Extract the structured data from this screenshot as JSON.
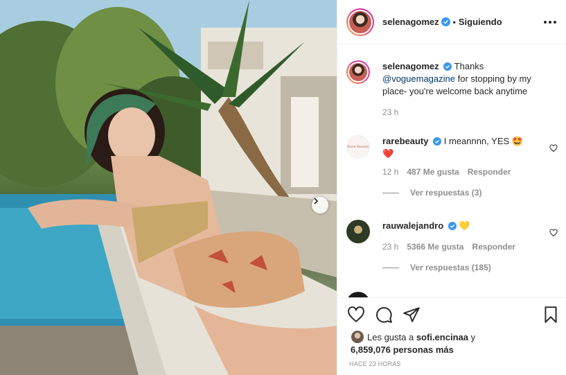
{
  "colors": {
    "link": "#00376b",
    "secondary": "#8e8e8e",
    "verified": "#3897f0",
    "text": "#262626"
  },
  "post": {
    "image_alt": "",
    "carousel_next_icon": "chevron-right-icon"
  },
  "header": {
    "username": "selenagomez",
    "separator": "•",
    "follow_status": "Siguiendo",
    "more_icon": "more-horizontal-icon"
  },
  "caption": {
    "username": "selenagomez",
    "text_before": "Thanks ",
    "mention": "@voguemagazine",
    "text_after": " for stopping by my place- you're welcome back anytime",
    "time": "23 h"
  },
  "comments": [
    {
      "username": "rarebeauty",
      "text": "I meannnn, YES 🤩",
      "emoji_line": "❤️",
      "avatar_text": "Rare Beauty",
      "time": "12 h",
      "likes": "487 Me gusta",
      "reply_label": "Responder",
      "view_replies": "Ver respuestas (3)"
    },
    {
      "username": "rauwalejandro",
      "text": "💛",
      "time": "23 h",
      "likes": "5366 Me gusta",
      "reply_label": "Responder",
      "view_replies": "Ver respuestas (185)"
    }
  ],
  "actions": {
    "like_icon": "heart-icon",
    "comment_icon": "comment-icon",
    "share_icon": "send-icon",
    "save_icon": "bookmark-icon"
  },
  "likes": {
    "prefix": "Les gusta a ",
    "user": "sofi.encinaa",
    "middle": " y",
    "count": "6,859,076 personas más"
  },
  "timestamp": "HACE 23 HORAS"
}
